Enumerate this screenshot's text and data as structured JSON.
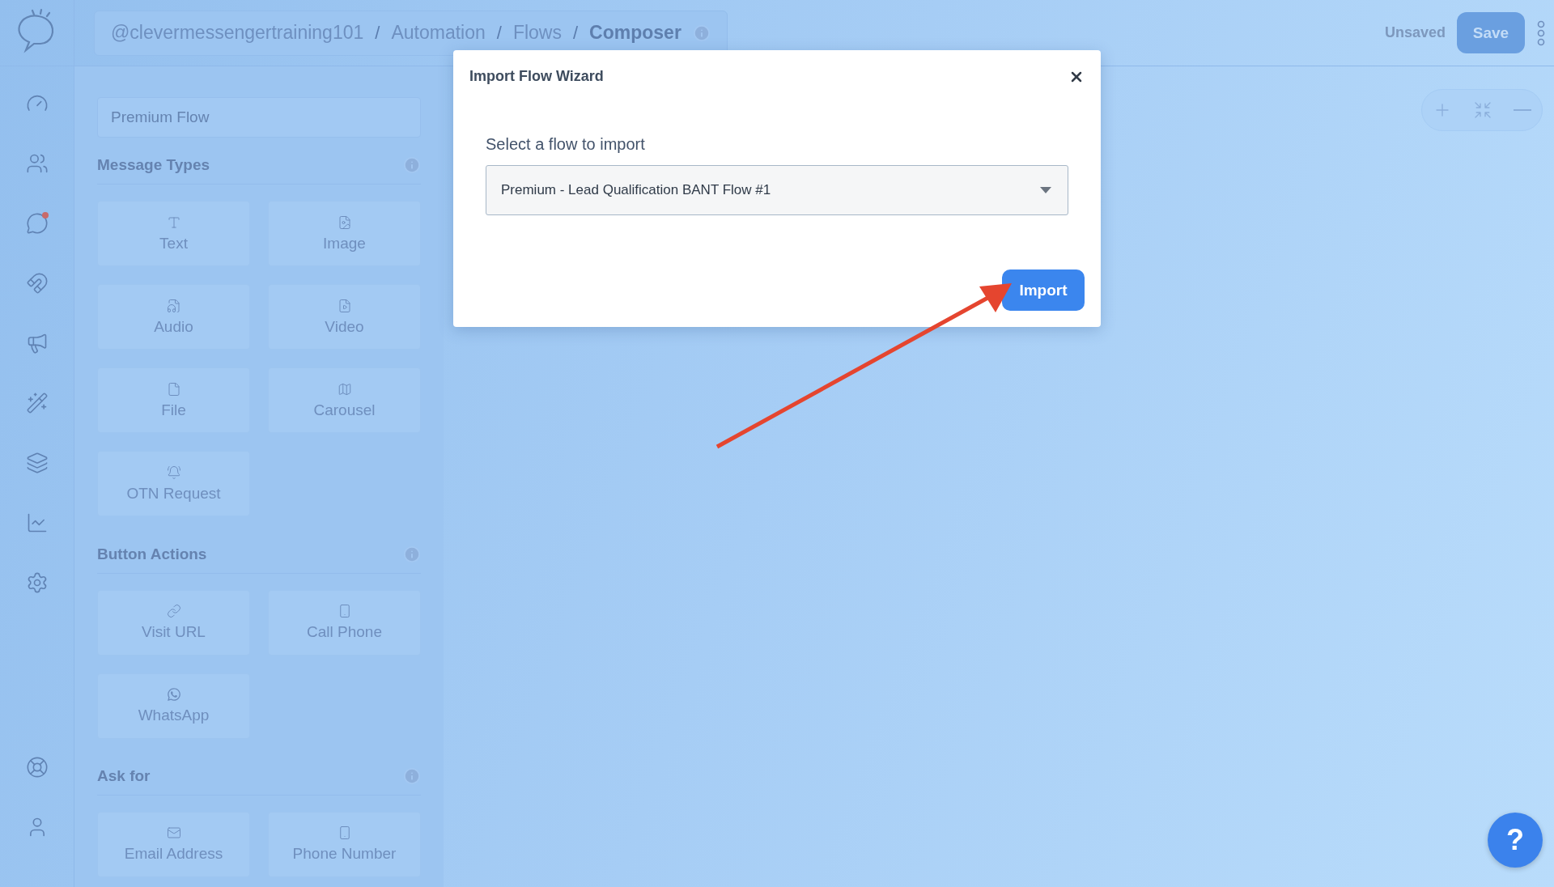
{
  "header": {
    "separator": "/",
    "breadcrumbs": [
      "@clevermessengertraining101",
      "Automation",
      "Flows",
      "Composer"
    ],
    "status": "Unsaved",
    "save_button": "Save"
  },
  "nav": [
    {
      "kind": "dashboard",
      "badge": false
    },
    {
      "kind": "contacts",
      "badge": false
    },
    {
      "kind": "chat",
      "badge": true
    },
    {
      "kind": "magnet",
      "badge": false
    },
    {
      "kind": "broadcast",
      "badge": false
    },
    {
      "kind": "automation",
      "badge": false
    },
    {
      "kind": "layers",
      "badge": false
    },
    {
      "kind": "analytics",
      "badge": false
    },
    {
      "kind": "settings",
      "badge": false
    }
  ],
  "nav_bottom": [
    {
      "kind": "support",
      "badge": false
    },
    {
      "kind": "account",
      "badge": false
    }
  ],
  "flow_name": {
    "value": "Premium Flow"
  },
  "sections": [
    {
      "title": "Message Types",
      "items": [
        {
          "label": "Text",
          "kind": "text"
        },
        {
          "label": "Image",
          "kind": "image"
        },
        {
          "label": "Audio",
          "kind": "audio"
        },
        {
          "label": "Video",
          "kind": "video"
        },
        {
          "label": "File",
          "kind": "file"
        },
        {
          "label": "Carousel",
          "kind": "carousel"
        },
        {
          "label": "OTN Request",
          "kind": "otn"
        }
      ]
    },
    {
      "title": "Button Actions",
      "items": [
        {
          "label": "Visit URL",
          "kind": "link"
        },
        {
          "label": "Call Phone",
          "kind": "phone"
        },
        {
          "label": "WhatsApp",
          "kind": "whatsapp"
        }
      ]
    },
    {
      "title": "Ask for",
      "items": [
        {
          "label": "Email Address",
          "kind": "email"
        },
        {
          "label": "Phone Number",
          "kind": "phone"
        }
      ]
    }
  ],
  "modal": {
    "title": "Import Flow Wizard",
    "label": "Select a flow to import",
    "select_value": "Premium - Lead Qualification BANT Flow #1",
    "button": "Import"
  },
  "help_button": "?"
}
